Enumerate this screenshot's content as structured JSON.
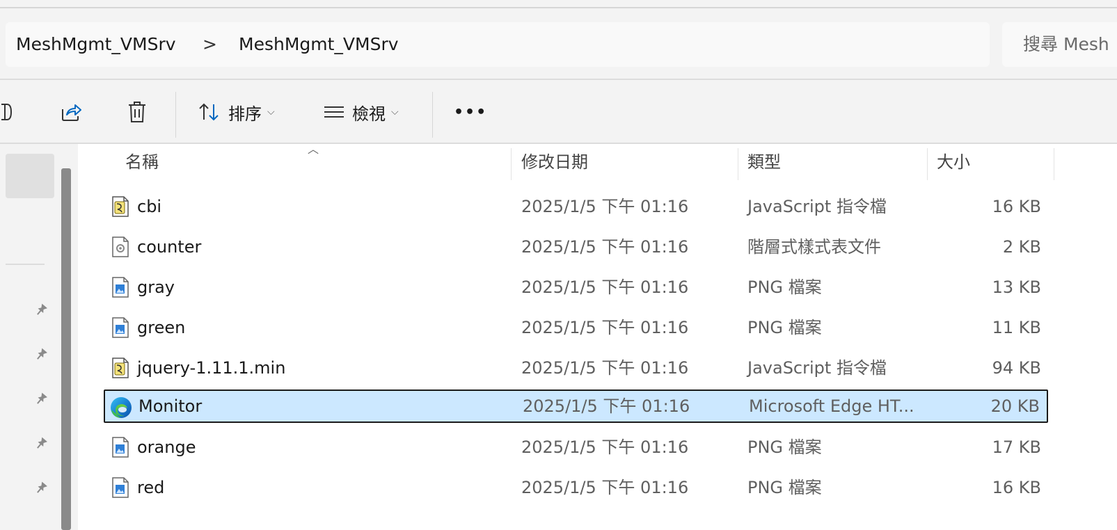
{
  "address_bar": {
    "crumbs": [
      "MeshMgmt_VMSrv",
      "MeshMgmt_VMSrv"
    ],
    "separator": ">"
  },
  "search": {
    "placeholder": "搜尋 Mesh"
  },
  "toolbar": {
    "sort_label": "排序",
    "view_label": "檢視",
    "more_label": "•••"
  },
  "columns": {
    "name": "名稱",
    "date": "修改日期",
    "type": "類型",
    "size": "大小"
  },
  "files": [
    {
      "name": "cbi",
      "date": "2025/1/5 下午 01:16",
      "type": "JavaScript 指令檔",
      "size": "16 KB",
      "icon": "script-file-icon"
    },
    {
      "name": "counter",
      "date": "2025/1/5 下午 01:16",
      "type": "階層式樣式表文件",
      "size": "2 KB",
      "icon": "css-file-icon"
    },
    {
      "name": "gray",
      "date": "2025/1/5 下午 01:16",
      "type": "PNG 檔案",
      "size": "13 KB",
      "icon": "image-file-icon"
    },
    {
      "name": "green",
      "date": "2025/1/5 下午 01:16",
      "type": "PNG 檔案",
      "size": "11 KB",
      "icon": "image-file-icon"
    },
    {
      "name": "jquery-1.11.1.min",
      "date": "2025/1/5 下午 01:16",
      "type": "JavaScript 指令檔",
      "size": "94 KB",
      "icon": "script-file-icon"
    },
    {
      "name": "Monitor",
      "date": "2025/1/5 下午 01:16",
      "type": "Microsoft Edge HT...",
      "size": "20 KB",
      "icon": "edge-html-file-icon",
      "selected": true
    },
    {
      "name": "orange",
      "date": "2025/1/5 下午 01:16",
      "type": "PNG 檔案",
      "size": "17 KB",
      "icon": "image-file-icon"
    },
    {
      "name": "red",
      "date": "2025/1/5 下午 01:16",
      "type": "PNG 檔案",
      "size": "16 KB",
      "icon": "image-file-icon"
    }
  ],
  "colors": {
    "selection_bg": "#cce8ff",
    "accent": "#0067c0"
  }
}
